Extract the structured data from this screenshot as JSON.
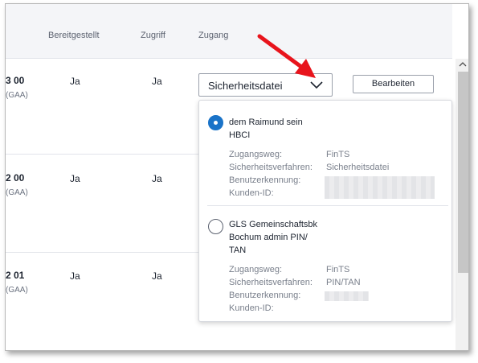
{
  "table": {
    "headers": [
      "Bereitgestellt",
      "Zugriff",
      "Zugang"
    ],
    "rows": [
      {
        "id": "3 00",
        "sub": "(GAA)",
        "bereitgestellt": "Ja",
        "zugriff": "Ja"
      },
      {
        "id": "2 00",
        "sub": "(GAA)",
        "bereitgestellt": "Ja",
        "zugriff": "Ja"
      },
      {
        "id": "2 01",
        "sub": "(GAA)",
        "bereitgestellt": "Ja",
        "zugriff": "Ja"
      }
    ]
  },
  "select": {
    "value": "Sicherheitsdatei"
  },
  "edit_button": {
    "label": "Bearbeiten"
  },
  "dropdown": {
    "options": [
      {
        "selected": true,
        "title_line1": "dem Raimund sein",
        "title_line2": "HBCI",
        "labels": [
          "Zugangsweg:",
          "Sicherheitsverfahren:",
          "Benutzerkennung:",
          "Kunden-ID:"
        ],
        "values": [
          "FinTS",
          "Sicherheitsdatei"
        ]
      },
      {
        "selected": false,
        "title_line1": "GLS Gemeinschaftsbk",
        "title_line2": "Bochum admin PIN/",
        "title_line3": "TAN",
        "labels": [
          "Zugangsweg:",
          "Sicherheitsverfahren:",
          "Benutzerkennung:",
          "Kunden-ID:"
        ],
        "values": [
          "FinTS",
          "PIN/TAN"
        ]
      }
    ]
  },
  "colors": {
    "accent": "#1a73c8",
    "annotation_arrow": "#e8141c"
  }
}
